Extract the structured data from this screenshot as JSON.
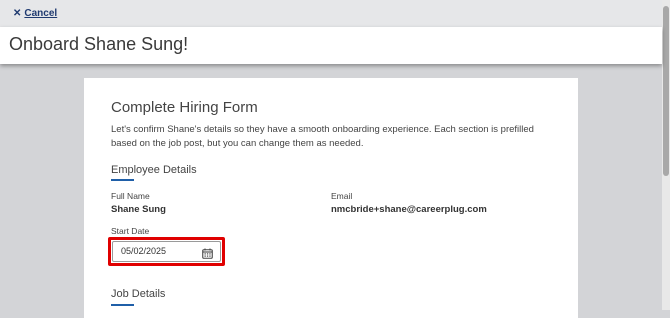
{
  "header": {
    "cancel_icon": "close-icon",
    "cancel_label": "Cancel",
    "page_title": "Onboard Shane Sung!"
  },
  "form": {
    "title": "Complete Hiring Form",
    "intro": "Let's confirm Shane's details so they have a smooth onboarding experience. Each section is prefilled based on the job post, but you can change them as needed.",
    "employee_section": {
      "heading": "Employee Details",
      "full_name_label": "Full Name",
      "full_name_value": "Shane Sung",
      "email_label": "Email",
      "email_value": "nmcbride+shane@careerplug.com",
      "start_date_label": "Start Date",
      "start_date_value": "05/02/2025",
      "calendar_icon": "calendar-icon"
    },
    "job_section": {
      "heading": "Job Details"
    }
  },
  "colors": {
    "accent_underline": "#1f5fa8",
    "highlight_border": "#e00000",
    "link": "#1f3a70"
  }
}
